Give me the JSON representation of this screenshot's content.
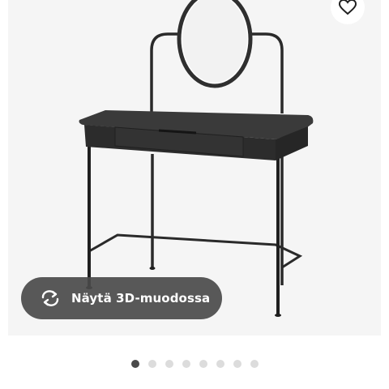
{
  "product_viewer": {
    "view_3d_label": "Näytä 3D-muodossa",
    "view_3d_icon": "rotate-arrows-icon",
    "favorite_icon": "heart-icon",
    "image_count": 8,
    "active_image_index": 1
  },
  "colors": {
    "image_background": "#f5f5f5",
    "button_background": "#4a4a4a",
    "button_text": "#ffffff",
    "dot_active": "#4a4a4a",
    "dot_inactive": "#dcdcdc"
  }
}
